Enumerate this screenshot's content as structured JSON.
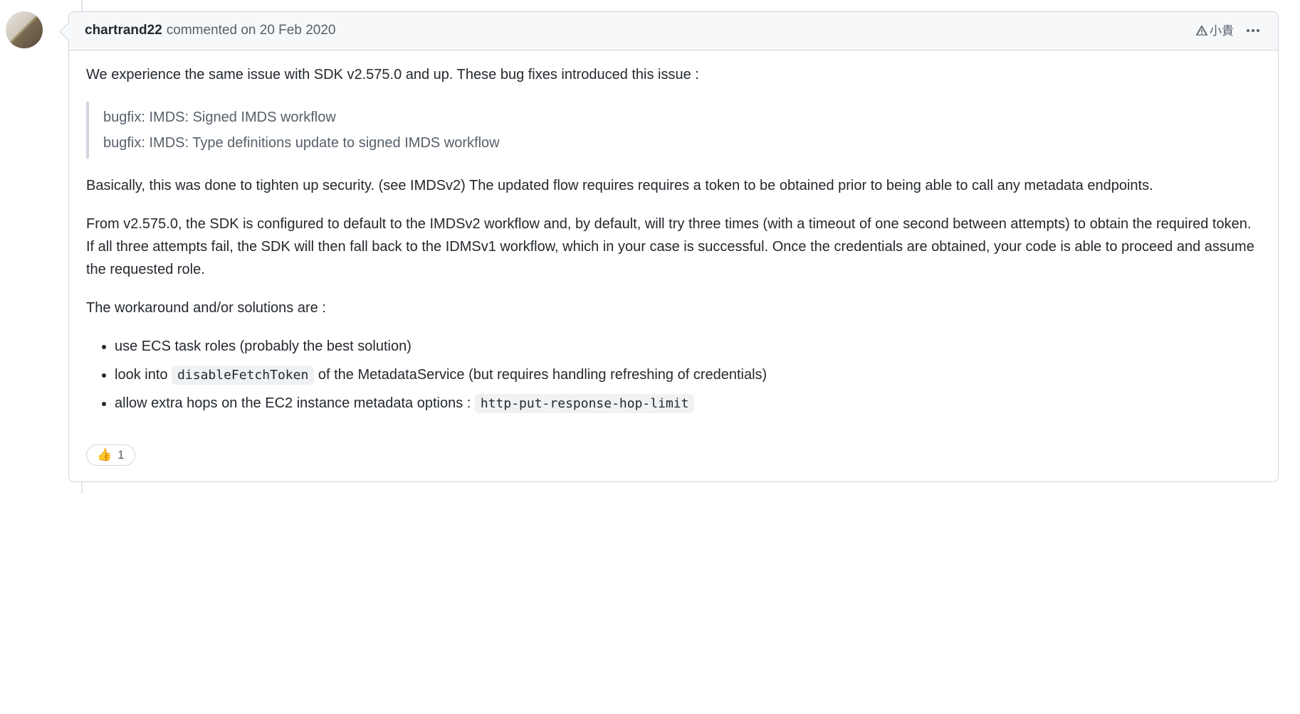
{
  "comment": {
    "author": "chartrand22",
    "action_text": "commented",
    "timestamp": "on 20 Feb 2020",
    "header_badge": "小貴",
    "body": {
      "intro": "We experience the same issue with SDK v2.575.0 and up. These bug fixes introduced this issue :",
      "quote_lines": [
        "bugfix: IMDS: Signed IMDS workflow",
        "bugfix: IMDS: Type definitions update to signed IMDS workflow"
      ],
      "para1": "Basically, this was done to tighten up security. (see IMDSv2) The updated flow requires requires a token to be obtained prior to being able to call any metadata endpoints.",
      "para2": "From v2.575.0, the SDK is configured to default to the IMDSv2 workflow and, by default, will try three times (with a timeout of one second between attempts) to obtain the required token. If all three attempts fail, the SDK will then fall back to the IDMSv1 workflow, which in your case is successful. Once the credentials are obtained, your code is able to proceed and assume the requested role.",
      "workaround_intro": "The workaround and/or solutions are :",
      "solutions": {
        "item0": "use ECS task roles (probably the best solution)",
        "item1_pre": "look into ",
        "item1_code": "disableFetchToken",
        "item1_post": " of the MetadataService (but requires handling refreshing of credentials)",
        "item2_pre": "allow extra hops on the EC2 instance metadata options : ",
        "item2_code": "http-put-response-hop-limit"
      }
    },
    "reactions": {
      "thumbs_up_emoji": "👍",
      "thumbs_up_count": "1"
    }
  }
}
